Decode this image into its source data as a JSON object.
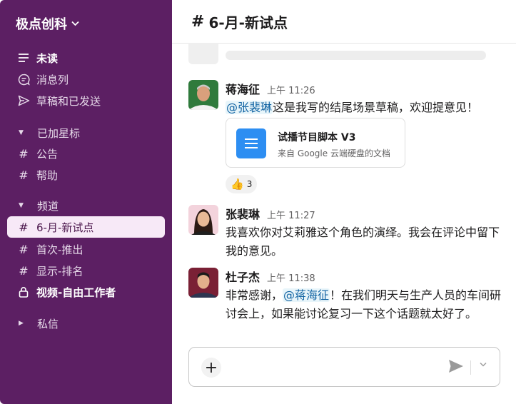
{
  "workspace": {
    "name": "极点创科"
  },
  "nav": [
    {
      "icon": "unread-icon",
      "label": "未读",
      "bold": true
    },
    {
      "icon": "threads-icon",
      "label": "消息列"
    },
    {
      "icon": "send-drafts-icon",
      "label": "草稿和已发送"
    }
  ],
  "sections": {
    "starred": {
      "label": "已加星标",
      "channels": [
        "公告",
        "帮助"
      ]
    },
    "channels": {
      "label": "频道",
      "channels": [
        "6-月-新试点",
        "首次-推出",
        "显示-排名"
      ],
      "private_channel": "视频-自由工作者"
    },
    "dms": {
      "label": "私信"
    }
  },
  "header": {
    "channel_name": "6-月-新试点"
  },
  "messages": [
    {
      "name": "蒋海征",
      "time": "上午 11:26",
      "mention": "@张裴琳",
      "text": "这是我写的结尾场景草稿，欢迎提意见！",
      "attachment": {
        "title": "试播节目脚本 V3",
        "subtitle": "来自 Google 云端硬盘的文档"
      },
      "reaction": {
        "emoji": "👍",
        "count": "3"
      }
    },
    {
      "name": "张裴琳",
      "time": "上午 11:27",
      "text": "我喜欢你对艾莉雅这个角色的演绎。我会在评论中留下我的意见。"
    },
    {
      "name": "杜子杰",
      "time": "上午 11:38",
      "text_before": "非常感谢，",
      "mention": "@蒋海征",
      "text_after": "！在我们明天与生产人员的车间研讨会上，如果能讨论复习一下这个话题就太好了。"
    }
  ],
  "colors": {
    "sidebar": "#5c1f63",
    "active_item": "#f7e9f7",
    "mention": "#1264a3",
    "doc_icon": "#2d8ef2"
  }
}
